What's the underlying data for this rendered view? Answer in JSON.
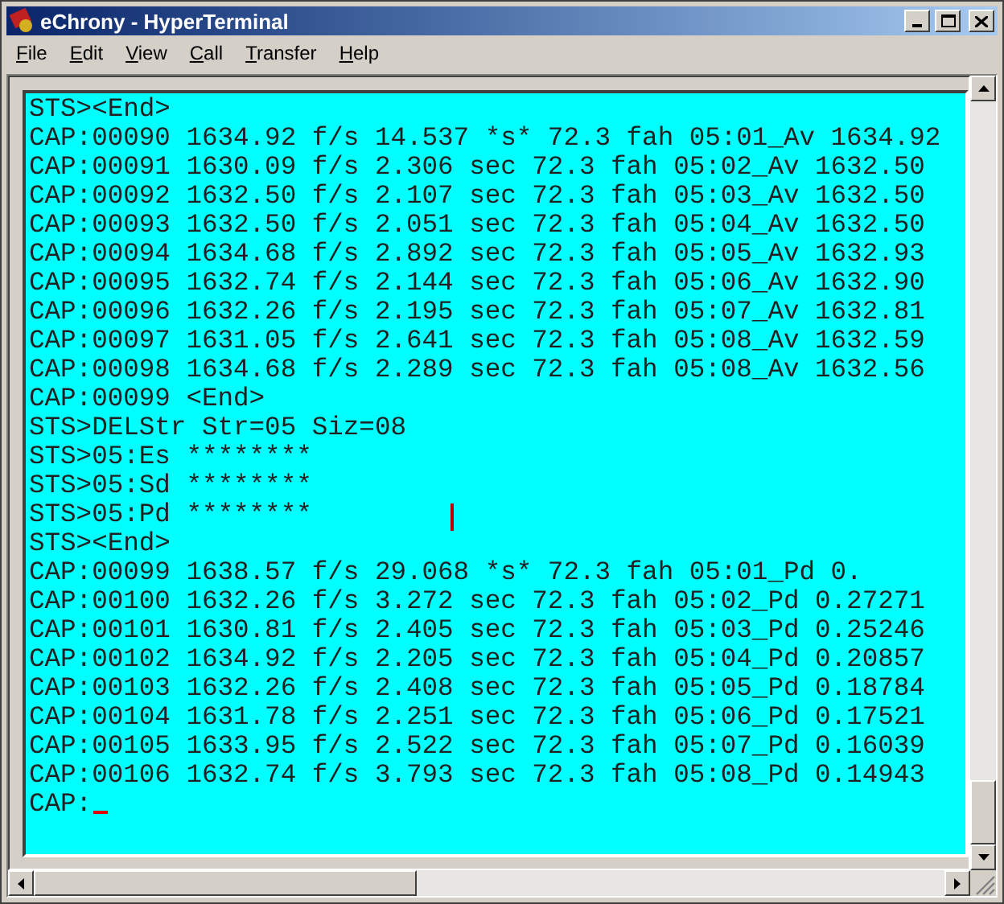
{
  "window": {
    "title": "eChrony - HyperTerminal"
  },
  "menu": [
    "File",
    "Edit",
    "View",
    "Call",
    "Transfer",
    "Help"
  ],
  "terminal": {
    "lines": [
      "STS><End>",
      "CAP:00090 1634.92 f/s 14.537 *s* 72.3 fah 05:01_Av 1634.92",
      "CAP:00091 1630.09 f/s 2.306 sec 72.3 fah 05:02_Av 1632.50",
      "CAP:00092 1632.50 f/s 2.107 sec 72.3 fah 05:03_Av 1632.50",
      "CAP:00093 1632.50 f/s 2.051 sec 72.3 fah 05:04_Av 1632.50",
      "CAP:00094 1634.68 f/s 2.892 sec 72.3 fah 05:05_Av 1632.93",
      "CAP:00095 1632.74 f/s 2.144 sec 72.3 fah 05:06_Av 1632.90",
      "CAP:00096 1632.26 f/s 2.195 sec 72.3 fah 05:07_Av 1632.81",
      "CAP:00097 1631.05 f/s 2.641 sec 72.3 fah 05:08_Av 1632.59",
      "CAP:00098 1634.68 f/s 2.289 sec 72.3 fah 05:08_Av 1632.56",
      "CAP:00099 <End>",
      "STS>DELStr Str=05 Siz=08",
      "STS>05:Es ********",
      "STS>05:Sd ********",
      "STS>05:Pd ********",
      "STS><End>",
      "CAP:00099 1638.57 f/s 29.068 *s* 72.3 fah 05:01_Pd 0.",
      "CAP:00100 1632.26 f/s 3.272 sec 72.3 fah 05:02_Pd 0.27271",
      "CAP:00101 1630.81 f/s 2.405 sec 72.3 fah 05:03_Pd 0.25246",
      "CAP:00102 1634.92 f/s 2.205 sec 72.3 fah 05:04_Pd 0.20857",
      "CAP:00103 1632.26 f/s 2.408 sec 72.3 fah 05:05_Pd 0.18784",
      "CAP:00104 1631.78 f/s 2.251 sec 72.3 fah 05:06_Pd 0.17521",
      "CAP:00105 1633.95 f/s 2.522 sec 72.3 fah 05:07_Pd 0.16039",
      "CAP:00106 1632.74 f/s 3.793 sec 72.3 fah 05:08_Pd 0.14943",
      "CAP:"
    ]
  }
}
